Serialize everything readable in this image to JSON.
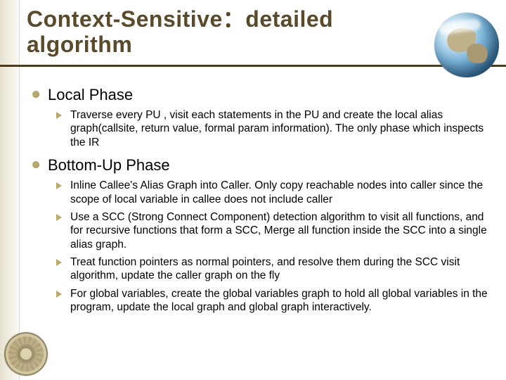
{
  "title": "Context-Sensitive：detailed algorithm",
  "sections": [
    {
      "heading": "Local Phase",
      "items": [
        "Traverse every PU , visit each statements in the PU and create the local alias graph(callsite, return value, formal param information). The only phase which inspects the IR"
      ]
    },
    {
      "heading": "Bottom-Up Phase",
      "items": [
        "Inline Callee's Alias Graph into Caller. Only copy reachable nodes into caller since the scope of local variable in callee does not include caller",
        "Use a SCC (Strong Connect Component) detection algorithm to visit all functions, and for recursive functions that form a SCC, Merge all function inside the SCC into a single alias graph.",
        "Treat function pointers as normal pointers, and resolve them during the SCC visit algorithm, update the caller graph on the fly",
        " For global variables, create the global variables graph to hold all global variables in the program, update the local graph and global graph interactively."
      ]
    }
  ]
}
